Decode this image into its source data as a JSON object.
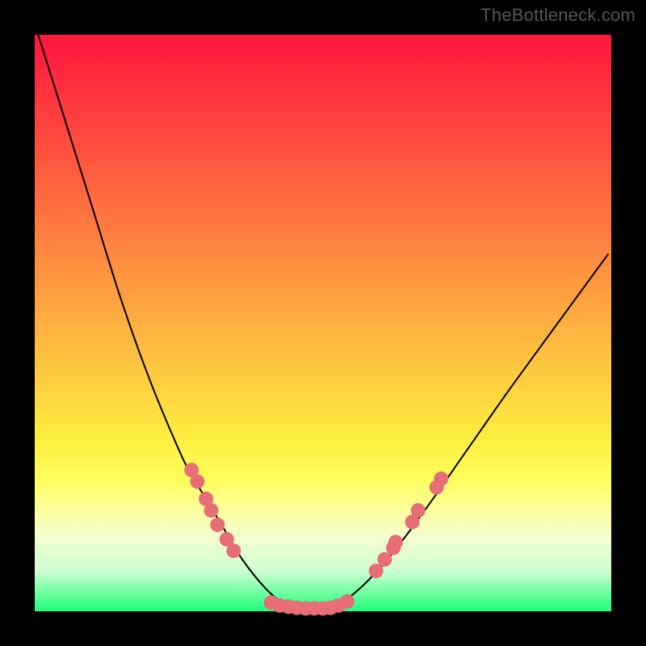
{
  "watermark": "TheBottleneck.com",
  "chart_data": {
    "type": "line",
    "title": "",
    "subtitle": "",
    "xlabel": "",
    "ylabel": "",
    "xlim": [
      0,
      1
    ],
    "ylim": [
      0,
      100
    ],
    "legend": false,
    "grid": false,
    "series": [
      {
        "name": "bottleneck-curve",
        "color": "#000000",
        "x": [
          0.006,
          0.05,
          0.1,
          0.15,
          0.2,
          0.25,
          0.27,
          0.3,
          0.33,
          0.36,
          0.4,
          0.43,
          0.46,
          0.485,
          0.51,
          0.54,
          0.58,
          0.62,
          0.68,
          0.75,
          0.82,
          0.9,
          0.995
        ],
        "y": [
          100,
          86,
          70,
          54,
          40,
          28,
          24,
          19,
          14,
          9,
          4,
          1.5,
          0.5,
          0,
          0.5,
          2,
          5.5,
          10,
          18,
          28,
          38,
          49,
          62
        ]
      }
    ],
    "marker_points": {
      "name": "highlight-dots",
      "color": "#e76e76",
      "radius_px": 9,
      "points": [
        {
          "x": 0.272,
          "y": 24.5
        },
        {
          "x": 0.282,
          "y": 22.5
        },
        {
          "x": 0.297,
          "y": 19.5
        },
        {
          "x": 0.306,
          "y": 17.5
        },
        {
          "x": 0.317,
          "y": 15.0
        },
        {
          "x": 0.333,
          "y": 12.5
        },
        {
          "x": 0.345,
          "y": 10.5
        },
        {
          "x": 0.41,
          "y": 1.5
        },
        {
          "x": 0.425,
          "y": 1.0
        },
        {
          "x": 0.44,
          "y": 0.8
        },
        {
          "x": 0.455,
          "y": 0.6
        },
        {
          "x": 0.47,
          "y": 0.5
        },
        {
          "x": 0.485,
          "y": 0.5
        },
        {
          "x": 0.5,
          "y": 0.5
        },
        {
          "x": 0.513,
          "y": 0.6
        },
        {
          "x": 0.527,
          "y": 1.0
        },
        {
          "x": 0.542,
          "y": 1.7
        },
        {
          "x": 0.592,
          "y": 7.0
        },
        {
          "x": 0.607,
          "y": 9.0
        },
        {
          "x": 0.622,
          "y": 11.0
        },
        {
          "x": 0.626,
          "y": 12.0
        },
        {
          "x": 0.655,
          "y": 15.5
        },
        {
          "x": 0.665,
          "y": 17.5
        },
        {
          "x": 0.697,
          "y": 21.5
        },
        {
          "x": 0.705,
          "y": 23.0
        }
      ]
    }
  }
}
